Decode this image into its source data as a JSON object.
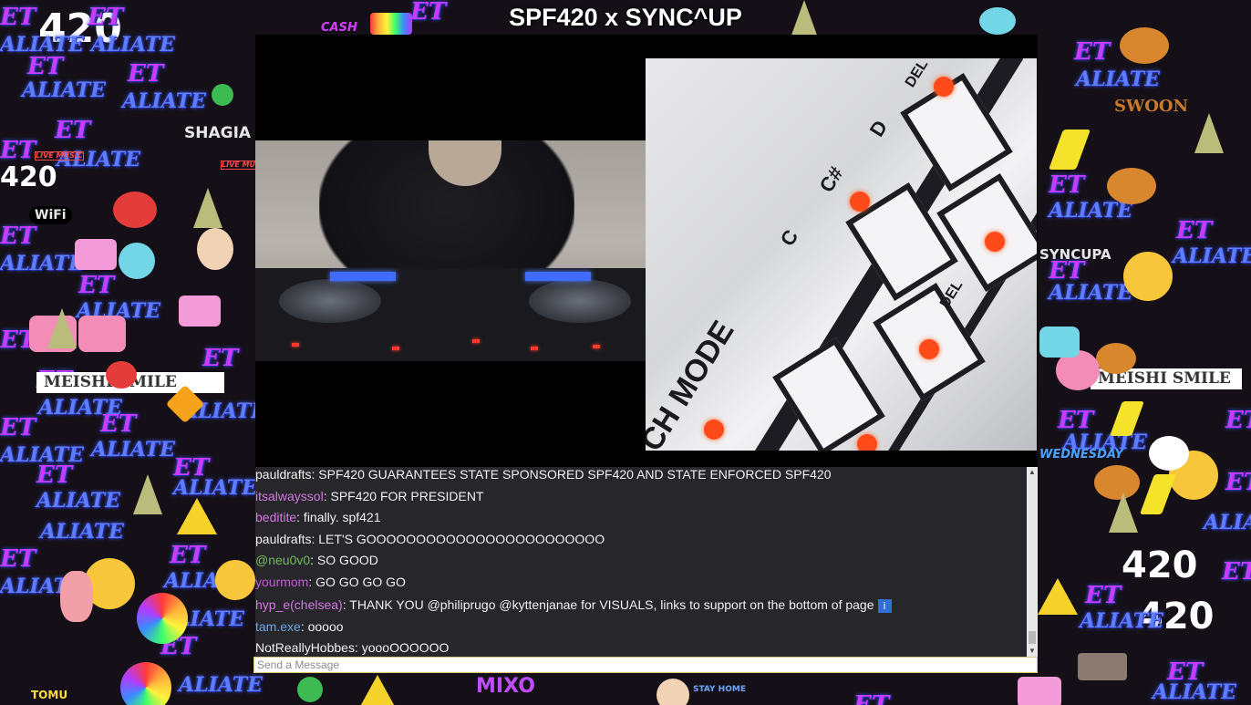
{
  "page": {
    "title": "SPF420 x SYNC^UP"
  },
  "stickers": {
    "et": "ET",
    "alt": "ALIATE",
    "n420": "420",
    "shagia": "SHAGIA",
    "wifi": "WiFi",
    "smile": "MEISHI SMILE",
    "synchupa": "SYNCUPA",
    "cash": "CASH",
    "wednesday": "WEDNESDAY",
    "swoon": "SWOON",
    "mixo": "MIXO",
    "stay_home": "STAY HOME",
    "tomu": "TOMU",
    "live_music": "LIVE MUSIC"
  },
  "stream": {
    "key_labels": [
      "C",
      "C#",
      "D",
      "DEL",
      "DEL",
      "CH MODE"
    ]
  },
  "chat": {
    "messages": [
      {
        "user": "pauldrafts",
        "color": "#f2f2f2",
        "text": ": SPF420 GUARANTEES STATE SPONSORED SPF420 AND STATE ENFORCED SPF420"
      },
      {
        "user": "itsalwayssol",
        "color": "#d479e0",
        "text": ": SPF420 FOR PRESIDENT"
      },
      {
        "user": "beditite",
        "color": "#d479e0",
        "text": ": finally. spf421"
      },
      {
        "user": "pauldrafts",
        "color": "#f2f2f2",
        "text": ": LET'S GOOOOOOOOOOOOOOOOOOOOOOOO"
      },
      {
        "user": "@neu0v0",
        "color": "#6fbf5a",
        "text": ": SO GOOD"
      },
      {
        "user": "yourmom",
        "color": "#c25bd4",
        "text": ": GO GO GO GO"
      },
      {
        "user": "hyp_e(chelsea)",
        "color": "#d479e0",
        "text": ": THANK YOU @philiprugo @kyttenjanae for VISUALS, links to support on the bottom of page"
      },
      {
        "user": "tam.exe",
        "color": "#6ea6e8",
        "text": ": ooooo"
      },
      {
        "user": "NotReallyHobbes",
        "color": "#f2f2f2",
        "text": ": yoooOOOOOO"
      }
    ],
    "info_icon": "i",
    "input_placeholder": "Send a Message"
  }
}
